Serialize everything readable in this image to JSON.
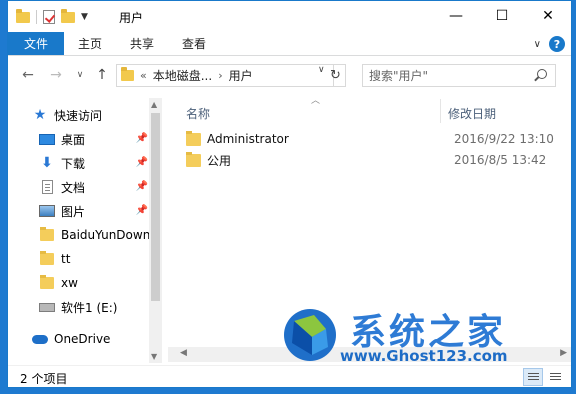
{
  "window": {
    "title": "用户"
  },
  "controls": {
    "minimize": "—",
    "maximize": "☐",
    "close": "✕"
  },
  "ribbon": {
    "tabs": [
      "文件",
      "主页",
      "共享",
      "查看"
    ],
    "expand_icon": "chevron-down-icon",
    "help_label": "?"
  },
  "address": {
    "overflow": "«",
    "segments": [
      "本地磁盘...",
      "用户"
    ],
    "separator": "›"
  },
  "search": {
    "placeholder": "搜索\"用户\""
  },
  "nav": {
    "quick_access": "快速访问",
    "items": [
      {
        "label": "桌面",
        "icon": "desktop-icon",
        "pinned": true
      },
      {
        "label": "下载",
        "icon": "download-icon",
        "pinned": true
      },
      {
        "label": "文档",
        "icon": "document-icon",
        "pinned": true
      },
      {
        "label": "图片",
        "icon": "pictures-icon",
        "pinned": true
      },
      {
        "label": "BaiduYunDown",
        "icon": "folder-icon",
        "pinned": false
      },
      {
        "label": "tt",
        "icon": "folder-icon",
        "pinned": false
      },
      {
        "label": "xw",
        "icon": "folder-icon",
        "pinned": false
      },
      {
        "label": "软件1 (E:)",
        "icon": "drive-icon",
        "pinned": false
      }
    ],
    "onedrive": "OneDrive"
  },
  "columns": {
    "name": "名称",
    "modified": "修改日期"
  },
  "files": [
    {
      "name": "Administrator",
      "modified": "2016/9/22 13:10"
    },
    {
      "name": "公用",
      "modified": "2016/8/5 13:42"
    }
  ],
  "status": {
    "item_count": "2 个项目"
  },
  "watermark": {
    "brand": "系统之家",
    "url": "www.Ghost123.com"
  }
}
